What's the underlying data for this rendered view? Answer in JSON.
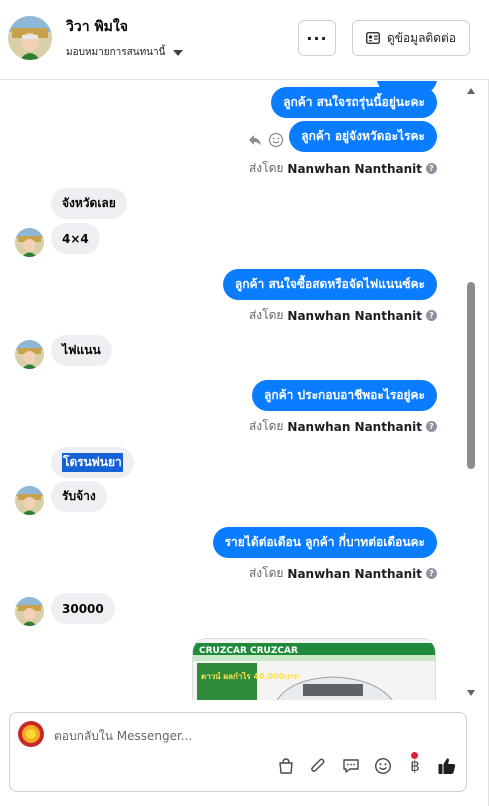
{
  "header": {
    "name": "วิวา พิมใจ",
    "assign_label": "มอบหมายการสนทนานี้",
    "more_label": "···",
    "contact_label": "ดูข้อมูลติดต่อ"
  },
  "messages": {
    "out1": "ลูกค้า สนใจรถรุ่นนี้อยู่นะคะ",
    "out2": "ลูกค้า อยู่จังหวัดอะไรคะ",
    "sent_prefix": "ส่งโดย",
    "sender": "Nanwhan Nanthanit",
    "in1": "จังหวัดเลย",
    "in2": "4×4",
    "out3": "ลูกค้า สนใจซื้อสดหรือจัดไฟแนนซ์คะ",
    "in3": "ไฟแนน",
    "out4": "ลูกค้า ประกอบอาชีพอะไรอยู่คะ",
    "in4": "โดรนพ่นยา",
    "in5": "รับจ้าง",
    "out5": "รายได้ต่อเดือน ลูกค้า กี่บาทต่อเดือนคะ",
    "in6": "30000",
    "image_text": "ดาวน์ ผลกำไร 40,000บาท",
    "image_brand": "CRUZCAR CRUZCAR"
  },
  "composer": {
    "placeholder": "ตอบกลับใน Messenger..."
  },
  "colors": {
    "accent": "#0a7cff",
    "incoming_bubble": "#eeeff2",
    "badge": "#e41e3f"
  },
  "icons": [
    "more-icon",
    "contact-card-icon",
    "reply-icon",
    "react-icon",
    "info-icon",
    "bag-icon",
    "attach-icon",
    "saved-reply-icon",
    "emoji-icon",
    "baht-icon",
    "like-icon"
  ]
}
